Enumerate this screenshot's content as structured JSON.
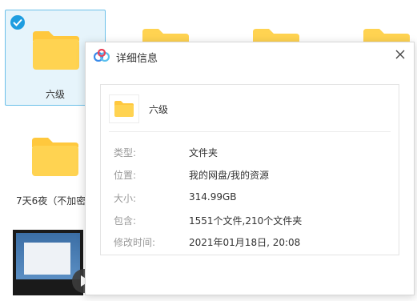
{
  "tiles": [
    {
      "label": "六级",
      "selected": true
    },
    {
      "label": "7天6夜（不加密"
    }
  ],
  "dialog": {
    "title": "详细信息",
    "item_name": "六级",
    "properties": [
      {
        "label": "类型:",
        "value": "文件夹"
      },
      {
        "label": "位置:",
        "value": "我的网盘/我的资源"
      },
      {
        "label": "大小:",
        "value": "314.99GB"
      },
      {
        "label": "包含:",
        "value": "1551个文件,210个文件夹"
      },
      {
        "label": "修改时间:",
        "value": "2021年01月18日, 20:08"
      }
    ]
  },
  "colors": {
    "folder": "#ffd351",
    "folder_tab": "#ffc83d",
    "selection_bg": "#e6f4fb",
    "selection_border": "#6cc0e9",
    "check": "#1e9de0"
  }
}
